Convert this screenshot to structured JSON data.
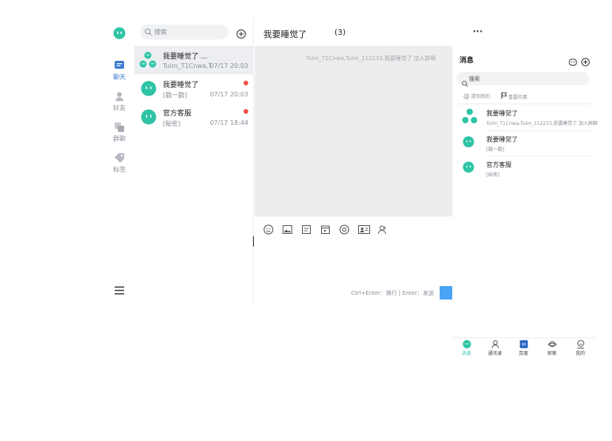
{
  "rail": {
    "items": [
      {
        "label": "聊天",
        "icon": "chat-icon",
        "active": true
      },
      {
        "label": "好友",
        "icon": "friends-icon"
      },
      {
        "label": "群聊",
        "icon": "group-icon"
      },
      {
        "label": "标签",
        "icon": "tag-icon"
      }
    ],
    "menu_icon": "menu-icon"
  },
  "list": {
    "search_placeholder": "搜索",
    "conversations": [
      {
        "name": "我要睡觉了 ...",
        "sub": "Tulm_T1Cnwa,T...",
        "time": "07/17 20:03",
        "unread": false
      },
      {
        "name": "我要睡觉了",
        "sub": "[戳一戳]",
        "time": "07/17 20:03",
        "unread": true
      },
      {
        "name": "官方客服",
        "sub": "[秘密]",
        "time": "07/17 18:44",
        "unread": true
      }
    ]
  },
  "chat": {
    "title": "我要睡觉了",
    "count": "(3)",
    "more": "···",
    "system_message": "Tulm_T1Cnwa,Tulm_112233,我要睡觉了 加入群聊",
    "input_hint": "Ctrl+Enter：换行 | Enter：发送"
  },
  "phone": {
    "title": "消息",
    "search_placeholder": "搜索",
    "filters": [
      "提到我的",
      "重要的事"
    ],
    "items": [
      {
        "name": "我要睡觉了",
        "sub": "Tulm_T1Cnwa,Tulm_112233,我要睡觉了 加入群聊"
      },
      {
        "name": "我要睡觉了",
        "sub": "[戳一戳]"
      },
      {
        "name": "官方客服",
        "sub": "[秘密]"
      }
    ],
    "tabs": [
      {
        "label": "消息",
        "active": true
      },
      {
        "label": "通讯录"
      },
      {
        "label": "百度"
      },
      {
        "label": "探索"
      },
      {
        "label": "我的"
      }
    ]
  },
  "colors": {
    "brand_green": "#2ec4a5",
    "accent_blue": "#3a7bd5",
    "unread_red": "#f0504a",
    "send_blue": "#4aa3f5"
  }
}
